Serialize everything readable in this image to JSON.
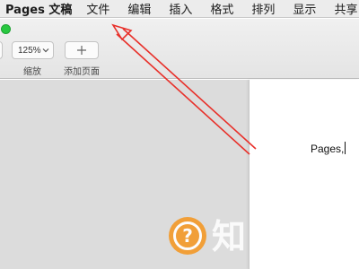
{
  "menubar": {
    "app_name": "Pages 文稿",
    "items": [
      "文件",
      "编辑",
      "插入",
      "格式",
      "排列",
      "显示",
      "共享"
    ]
  },
  "toolbar": {
    "zoom": {
      "value": "125%",
      "label": "缩放"
    },
    "add_page": {
      "label": "添加页面"
    }
  },
  "document": {
    "text": "Pages,"
  },
  "watermark": {
    "icon": "question-mark-icon",
    "text": "知"
  },
  "annotation": {
    "color": "#e8302a"
  },
  "colors": {
    "traffic_green": "#28c840",
    "watermark_orange": "#f39a2b"
  }
}
